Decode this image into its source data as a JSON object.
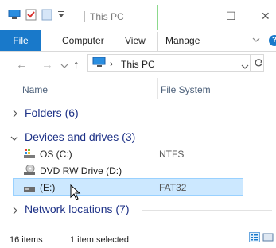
{
  "window": {
    "title": "This PC",
    "minimize": "—",
    "maximize": "☐",
    "close": "✕"
  },
  "ribbon": {
    "tabs": [
      "File",
      "Computer",
      "View",
      "Manage"
    ],
    "help": "?"
  },
  "address": {
    "path": "This PC",
    "separator": "›"
  },
  "columns": [
    "Name",
    "File System"
  ],
  "groups": {
    "folders": "Folders (6)",
    "devices": "Devices and drives (3)",
    "network": "Network locations (7)"
  },
  "drives": [
    {
      "name": "OS (C:)",
      "fs": "NTFS"
    },
    {
      "name": "DVD RW Drive (D:)",
      "fs": ""
    },
    {
      "name": "(E:)",
      "fs": "FAT32"
    }
  ],
  "status": {
    "items": "16 items",
    "selected": "1 item selected"
  },
  "colors": {
    "accent": "#1979ca",
    "selection": "#cce8ff",
    "group_text": "#1e3287"
  }
}
